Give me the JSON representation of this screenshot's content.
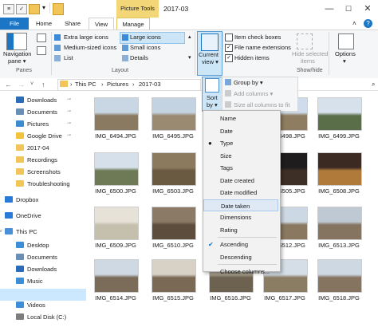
{
  "titlebar": {
    "contextual_tab": "Picture Tools",
    "title": "2017-03",
    "qa_items": [
      "properties-icon",
      "checkmark-icon",
      "folder-icon"
    ],
    "minimize": "—",
    "maximize": "☐",
    "close": "✕"
  },
  "tabs": [
    "File",
    "Home",
    "Share",
    "View",
    "Manage"
  ],
  "ribbon": {
    "panes": {
      "nav_label": "Navigation",
      "nav_sub": "pane ▾",
      "group": "Panes"
    },
    "layout": {
      "items": [
        "Extra large icons",
        "Large icons",
        "Medium-sized icons",
        "Small icons",
        "List",
        "Details"
      ],
      "group": "Layout"
    },
    "current_view": {
      "label1": "Current",
      "label2": "view ▾"
    },
    "sortgroup": {
      "sort1": "Sort",
      "sort2": "by ▾",
      "group_by": "Group by ▾",
      "add_columns": "Add columns ▾",
      "size_columns": "Size all columns to fit"
    },
    "show_hide": {
      "item_check_boxes": "Item check boxes",
      "file_name_extensions": "File name extensions",
      "hidden_items": "Hidden items",
      "hide_selected1": "Hide selected",
      "hide_selected2": "items",
      "group": "Show/hide"
    },
    "options": {
      "label1": "Options",
      "label2": "▾"
    }
  },
  "address": {
    "segments": [
      "This PC",
      "Pictures",
      "2017-03"
    ],
    "separator": "›"
  },
  "nav": {
    "items": [
      {
        "label": "Downloads",
        "icon": "downloads-icon",
        "color": "#2b6cb8",
        "pinned": true
      },
      {
        "label": "Documents",
        "icon": "documents-icon",
        "color": "#6a8fb6",
        "pinned": true
      },
      {
        "label": "Pictures",
        "icon": "pictures-icon",
        "color": "#3d8ccf",
        "pinned": true
      },
      {
        "label": "Google Drive",
        "icon": "google-drive-icon",
        "color": "#f2c23a",
        "pinned": true
      },
      {
        "label": "2017-04",
        "icon": "folder-icon",
        "color": "#f1c558",
        "pinned": false
      },
      {
        "label": "Recordings",
        "icon": "folder-icon",
        "color": "#f1c558",
        "pinned": false
      },
      {
        "label": "Screenshots",
        "icon": "folder-icon",
        "color": "#f1c558",
        "pinned": false
      },
      {
        "label": "Troubleshooting",
        "icon": "folder-icon",
        "color": "#f1c558",
        "pinned": false
      },
      {
        "label": "Dropbox",
        "icon": "dropbox-icon",
        "color": "#2a7ad8",
        "pinned": false
      },
      {
        "label": "OneDrive",
        "icon": "onedrive-icon",
        "color": "#2a7ad8",
        "pinned": false
      },
      {
        "label": "This PC",
        "icon": "this-pc-icon",
        "color": "#4a90d9",
        "pinned": false
      },
      {
        "label": "Desktop",
        "icon": "desktop-icon",
        "color": "#3c8fd6",
        "pinned": false
      },
      {
        "label": "Documents",
        "icon": "documents-icon",
        "color": "#6a8fb6",
        "pinned": false
      },
      {
        "label": "Downloads",
        "icon": "downloads-icon",
        "color": "#2b6cb8",
        "pinned": false
      },
      {
        "label": "Music",
        "icon": "music-icon",
        "color": "#3c8fd6",
        "pinned": false
      },
      {
        "label": "Pictures",
        "icon": "pictures-icon",
        "color": "#3d8ccf",
        "pinned": false
      },
      {
        "label": "Videos",
        "icon": "videos-icon",
        "color": "#3c8fd6",
        "pinned": false
      },
      {
        "label": "Local Disk (C:)",
        "icon": "drive-icon",
        "color": "#7d7d7d",
        "pinned": false
      }
    ],
    "pin_glyph": "📌"
  },
  "thumbnails": [
    {
      "name": "IMG_6494.JPG",
      "sky": "#c9d6e4",
      "ground": "#8a7a62"
    },
    {
      "name": "IMG_6495.JPG",
      "sky": "#c4d3e2",
      "ground": "#9a8a72"
    },
    {
      "name": "IMG_6497.JPG",
      "sky": "#c9d9ea",
      "ground": "#7d8a5a"
    },
    {
      "name": "IMG_6498.JPG",
      "sky": "#cfdceb",
      "ground": "#8e7d60"
    },
    {
      "name": "IMG_6499.JPG",
      "sky": "#d7e1ec",
      "ground": "#5a6e4a"
    },
    {
      "name": "IMG_6500.JPG",
      "sky": "#d6e0eb",
      "ground": "#6d7a55"
    },
    {
      "name": "IMG_6503.JPG",
      "sky": "#8b7a5e",
      "ground": "#6a5a42"
    },
    {
      "name": "IMG_6504.JPG",
      "sky": "#2a2622",
      "ground": "#6b5a44"
    },
    {
      "name": "IMG_6505.JPG",
      "sky": "#1e1c1c",
      "ground": "#3e2f26"
    },
    {
      "name": "IMG_6508.JPG",
      "sky": "#3a2a22",
      "ground": "#b07a3a"
    },
    {
      "name": "IMG_6509.JPG",
      "sky": "#e6e2d8",
      "ground": "#c5bfae"
    },
    {
      "name": "IMG_6510.JPG",
      "sky": "#8a7a66",
      "ground": "#5d4d3d"
    },
    {
      "name": "IMG_6511.JPG",
      "sky": "#d2dde9",
      "ground": "#8e7d62"
    },
    {
      "name": "IMG_6512.JPG",
      "sky": "#cdd8e5",
      "ground": "#8a7960"
    },
    {
      "name": "IMG_6513.JPG",
      "sky": "#bfc9d4",
      "ground": "#857560"
    },
    {
      "name": "IMG_6514.JPG",
      "sky": "#cfd9e3",
      "ground": "#7a6c58"
    },
    {
      "name": "IMG_6515.JPG",
      "sky": "#d8d2c6",
      "ground": "#7a6a55"
    },
    {
      "name": "IMG_6516.JPG",
      "sky": "#a8a08e",
      "ground": "#6d6250"
    },
    {
      "name": "IMG_6517.JPG",
      "sky": "#d5dee7",
      "ground": "#8b7c64"
    },
    {
      "name": "IMG_6518.JPG",
      "sky": "#cdd8e3",
      "ground": "#847460"
    }
  ],
  "sort_menu": {
    "items": [
      "Name",
      "Date",
      "Type",
      "Size",
      "Tags",
      "Date created",
      "Date modified",
      "Date taken",
      "Dimensions",
      "Rating"
    ],
    "selected": "Type",
    "hovered": "Date taken",
    "order_items": [
      "Ascending",
      "Descending"
    ],
    "order_selected": "Ascending",
    "choose": "Choose columns...",
    "bullet": "●",
    "check": "✔"
  },
  "colors": {
    "accent": "#1b76c6",
    "picture_tools": "#f3d677",
    "menu_hover": "#dfe9f5"
  }
}
